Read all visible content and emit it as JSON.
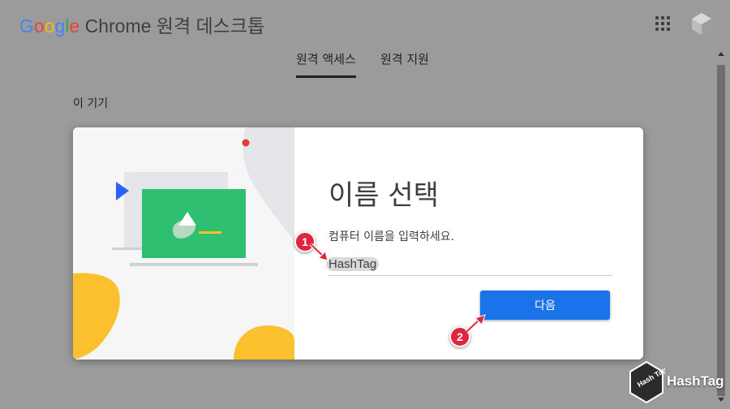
{
  "header": {
    "brand_letters": [
      "G",
      "o",
      "o",
      "g",
      "l",
      "e"
    ],
    "product": "Chrome 원격 데스크톱",
    "icons": [
      "apps-grid-icon",
      "account-avatar-icon"
    ]
  },
  "tabs": [
    {
      "label": "원격 액세스",
      "active": true
    },
    {
      "label": "원격 지원",
      "active": false
    }
  ],
  "section": {
    "label": "이 기기"
  },
  "dialog": {
    "title": "이름 선택",
    "instructions": "컴퓨터 이름을 입력하세요.",
    "name_value": "HashTag",
    "next_label": "다음"
  },
  "annotations": {
    "step1": "1",
    "step2": "2"
  },
  "watermark": {
    "text": "HashTag",
    "logo_letters": "Hash Tag"
  },
  "colors": {
    "accent": "#1a73e8",
    "marker": "#e0263f",
    "illustration_green": "#2fbf71",
    "illustration_yellow": "#fbc02d"
  }
}
